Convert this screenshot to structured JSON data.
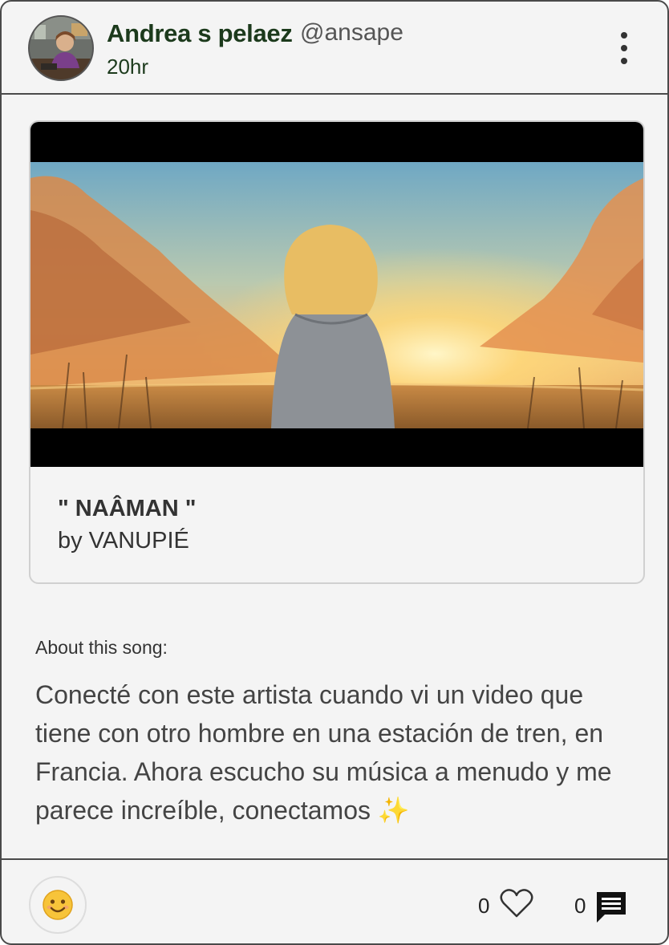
{
  "post": {
    "author_name": "Andrea s pelaez",
    "author_handle": "@ansape",
    "time_ago": "20hr"
  },
  "media": {
    "title": "\" NAÂMAN \"",
    "artist": "by VANUPIÉ"
  },
  "about": {
    "label": "About this song:",
    "text": "Conecté con este artista cuando vi un video que tiene con otro hombre en una estación de tren, en Francia. Ahora escucho su música a menudo y me parece increíble, conectamos ✨"
  },
  "actions": {
    "like_count": "0",
    "comment_count": "0"
  },
  "icons": {
    "menu": "more-vertical-icon",
    "reaction": "smiling-face-emoji-icon",
    "like": "heart-outline-icon",
    "comment": "comment-bubble-icon"
  },
  "colors": {
    "author_name": "#1c3a1c",
    "card_background": "#f4f4f4",
    "border": "#4a4a4a"
  }
}
